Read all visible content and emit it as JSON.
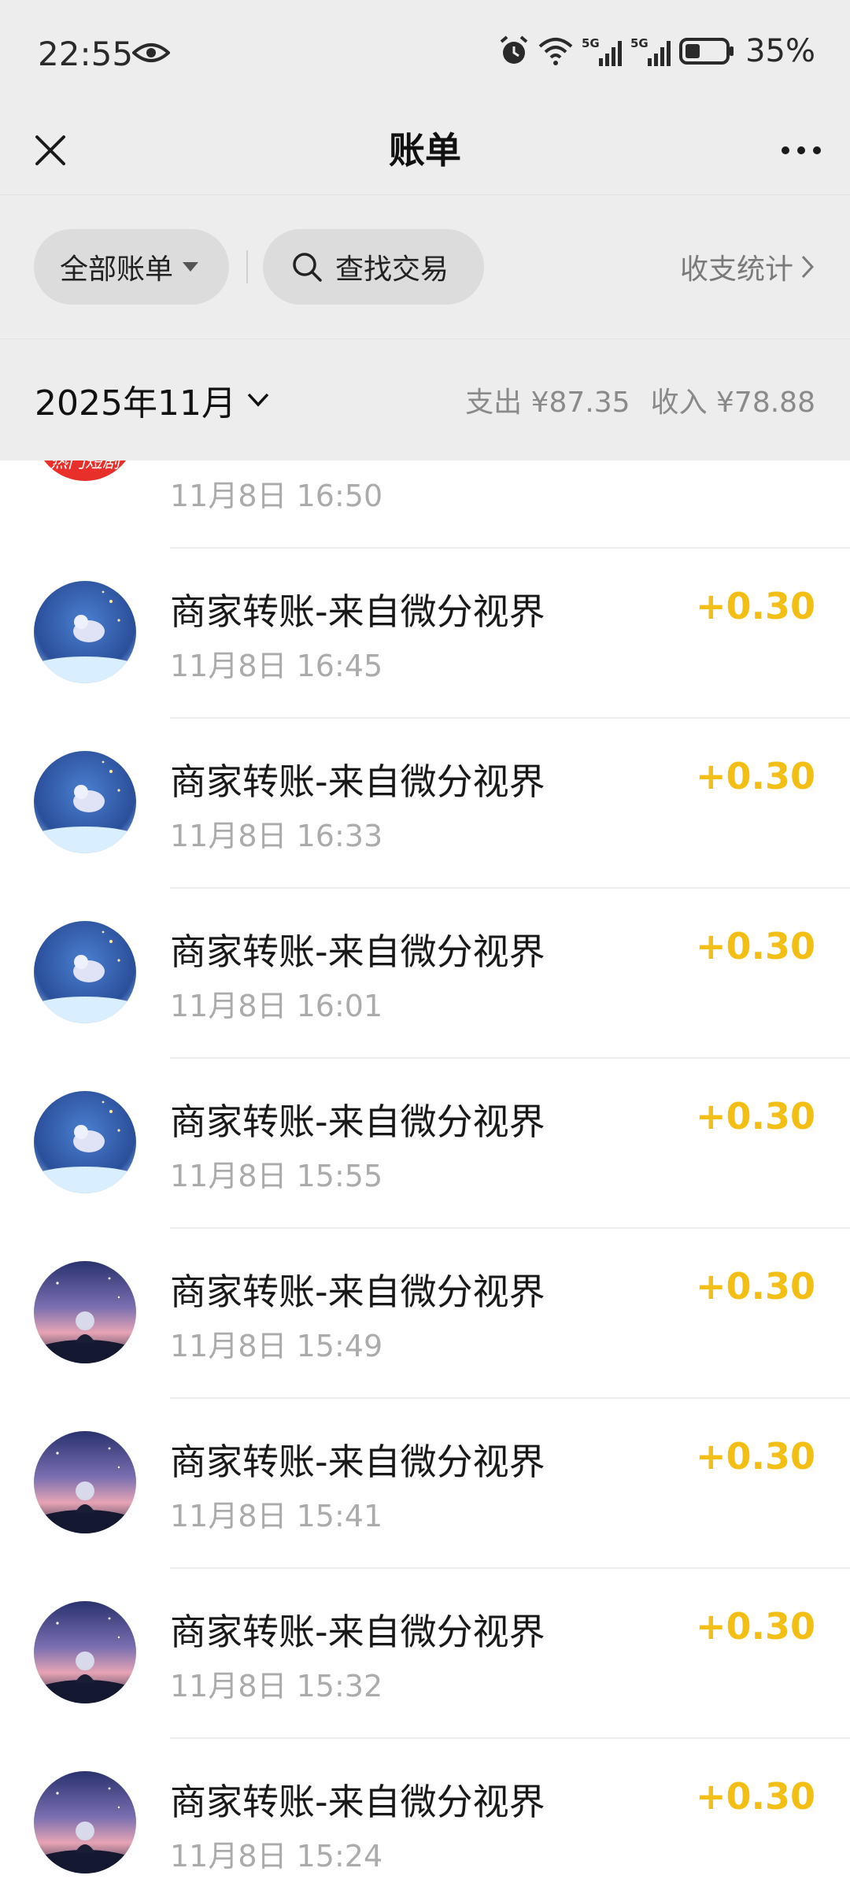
{
  "status_bar": {
    "time": "22:55",
    "battery_percent": "35%",
    "signal_labels": [
      "5G",
      "5G"
    ]
  },
  "nav": {
    "title": "账单"
  },
  "filters": {
    "all_bills": "全部账单",
    "search": "查找交易",
    "stats": "收支统计"
  },
  "month": {
    "label": "2025年11月",
    "expense": "支出 ¥87.35",
    "income": "收入 ¥78.88"
  },
  "partial_item": {
    "avatar_text": "热门短剧",
    "time": "11月8日 16:50"
  },
  "transactions": [
    {
      "title": "商家转账-来自微分视界",
      "time": "11月8日 16:45",
      "amount": "+0.30",
      "avatar": "moon"
    },
    {
      "title": "商家转账-来自微分视界",
      "time": "11月8日 16:33",
      "amount": "+0.30",
      "avatar": "moon"
    },
    {
      "title": "商家转账-来自微分视界",
      "time": "11月8日 16:01",
      "amount": "+0.30",
      "avatar": "moon"
    },
    {
      "title": "商家转账-来自微分视界",
      "time": "11月8日 15:55",
      "amount": "+0.30",
      "avatar": "moon"
    },
    {
      "title": "商家转账-来自微分视界",
      "time": "11月8日 15:49",
      "amount": "+0.30",
      "avatar": "sky"
    },
    {
      "title": "商家转账-来自微分视界",
      "time": "11月8日 15:41",
      "amount": "+0.30",
      "avatar": "sky"
    },
    {
      "title": "商家转账-来自微分视界",
      "time": "11月8日 15:32",
      "amount": "+0.30",
      "avatar": "sky"
    },
    {
      "title": "商家转账-来自微分视界",
      "time": "11月8日 15:24",
      "amount": "+0.30",
      "avatar": "sky"
    }
  ],
  "colors": {
    "income_amount": "#f3bf14",
    "header_bg": "#ededed",
    "pill_bg": "#dcdcdc"
  }
}
